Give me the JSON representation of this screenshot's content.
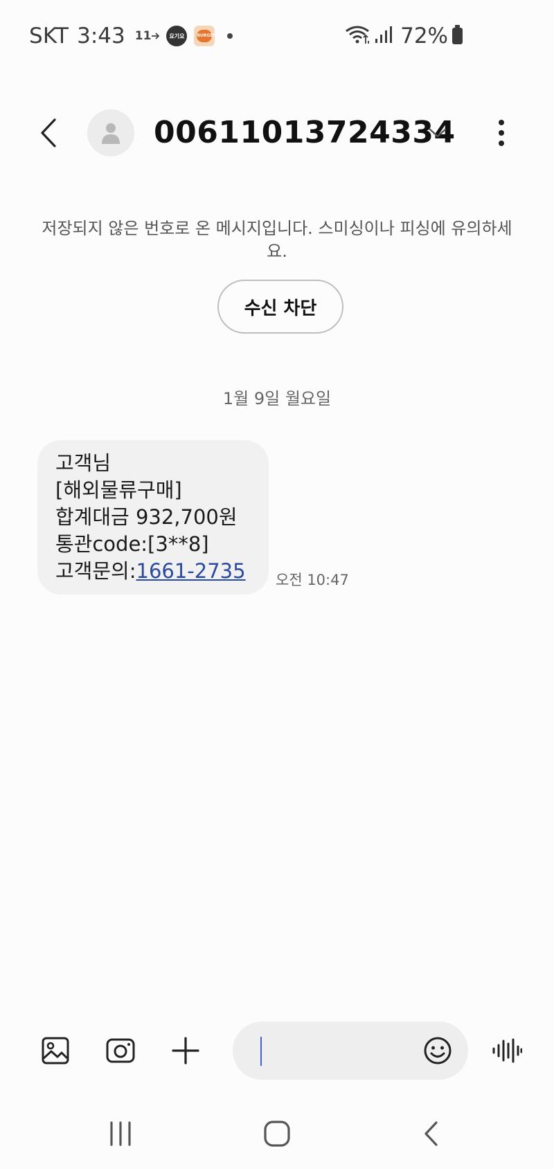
{
  "status_bar": {
    "carrier": "SKT",
    "time": "3:43",
    "noti_11st": "11",
    "noti_yogiyo": "요기요",
    "noti_burgerking": "BURGER KING",
    "battery": "72%"
  },
  "header": {
    "contact": "00611013724334"
  },
  "warning": {
    "text": "저장되지 않은 번호로 온 메시지입니다. 스미싱이나 피싱에 유의하세요.",
    "block_button": "수신 차단"
  },
  "conversation": {
    "date": "1월 9일 월요일",
    "message": {
      "lines": [
        "고객님",
        "[해외물류구매]",
        "합계대금 932,700원",
        "통관code:[3**8]"
      ],
      "inquiry_label": "고객문의:",
      "phone_link": "1661-2735",
      "time": "오전 10:47"
    }
  },
  "composer": {
    "input_value": "",
    "icons": [
      "gallery-icon",
      "camera-icon",
      "plus-icon",
      "emoji-icon",
      "voice-icon"
    ]
  },
  "colors": {
    "background": "#fcfcfc",
    "bubble": "#f1f1f1",
    "link": "#2a4aa0",
    "caret": "#3a64c8"
  }
}
